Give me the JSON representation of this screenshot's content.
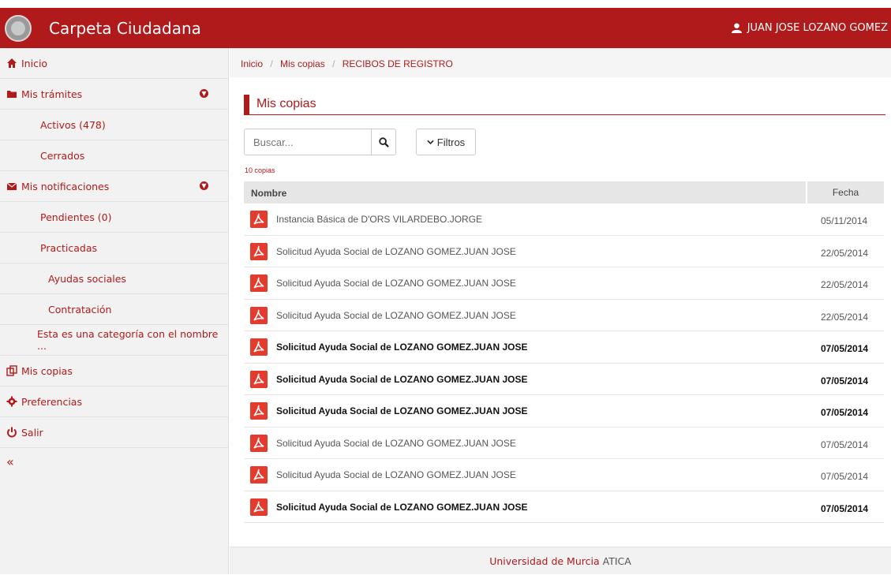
{
  "header": {
    "title": "Carpeta Ciudadana",
    "user": "JUAN JOSE LOZANO GOMEZ",
    "color": "#b11a1a"
  },
  "sidebar": {
    "inicio": "Inicio",
    "mis_tramites": "Mis trámites",
    "activos": "Activos (478)",
    "cerrados": "Cerrados",
    "mis_notificaciones": "Mis notificaciones",
    "pendientes": "Pendientes (0)",
    "practicadas": "Practicadas",
    "ayudas": "Ayudas sociales",
    "contratacion": "Contratación",
    "categoria": "Esta es una categoría con el nombre ...",
    "mis_copias": "Mis copias",
    "preferencias": "Preferencias",
    "salir": "Salir",
    "collapse": "«"
  },
  "breadcrumb": {
    "home": "Inicio",
    "sep1": "/",
    "mid": "Mis copias",
    "sep2": "/",
    "current": "RECIBOS DE REGISTRO"
  },
  "main": {
    "heading": "Mis copias",
    "search_placeholder": "Buscar...",
    "filtros": "Filtros",
    "count": "10 copias",
    "col_nombre": "Nombre",
    "col_fecha": "Fecha"
  },
  "rows": [
    {
      "name": "Instancia Básica de D'ORS VILARDEBO.JORGE",
      "date": "05/11/2014",
      "bold": false
    },
    {
      "name": "Solicitud Ayuda Social de LOZANO GOMEZ.JUAN JOSE",
      "date": "22/05/2014",
      "bold": false
    },
    {
      "name": "Solicitud Ayuda Social de LOZANO GOMEZ.JUAN JOSE",
      "date": "22/05/2014",
      "bold": false
    },
    {
      "name": "Solicitud Ayuda Social de LOZANO GOMEZ.JUAN JOSE",
      "date": "22/05/2014",
      "bold": false
    },
    {
      "name": "Solicitud Ayuda Social de LOZANO GOMEZ.JUAN JOSE",
      "date": "07/05/2014",
      "bold": true
    },
    {
      "name": "Solicitud Ayuda Social de LOZANO GOMEZ.JUAN JOSE",
      "date": "07/05/2014",
      "bold": true
    },
    {
      "name": "Solicitud Ayuda Social de LOZANO GOMEZ.JUAN JOSE",
      "date": "07/05/2014",
      "bold": true
    },
    {
      "name": "Solicitud Ayuda Social de LOZANO GOMEZ.JUAN JOSE",
      "date": "07/05/2014",
      "bold": false
    },
    {
      "name": "Solicitud Ayuda Social de LOZANO GOMEZ.JUAN JOSE",
      "date": "07/05/2014",
      "bold": false
    },
    {
      "name": "Solicitud Ayuda Social de LOZANO GOMEZ.JUAN JOSE",
      "date": "07/05/2014",
      "bold": true
    }
  ],
  "footer": {
    "org": "Universidad de Murcia",
    "unit": "ATICA"
  },
  "icons": [
    "home-icon",
    "folder-icon",
    "envelope-icon",
    "copies-icon",
    "gear-icon",
    "power-icon",
    "user-icon",
    "search-icon",
    "chevron-down-icon",
    "pdf-icon"
  ]
}
